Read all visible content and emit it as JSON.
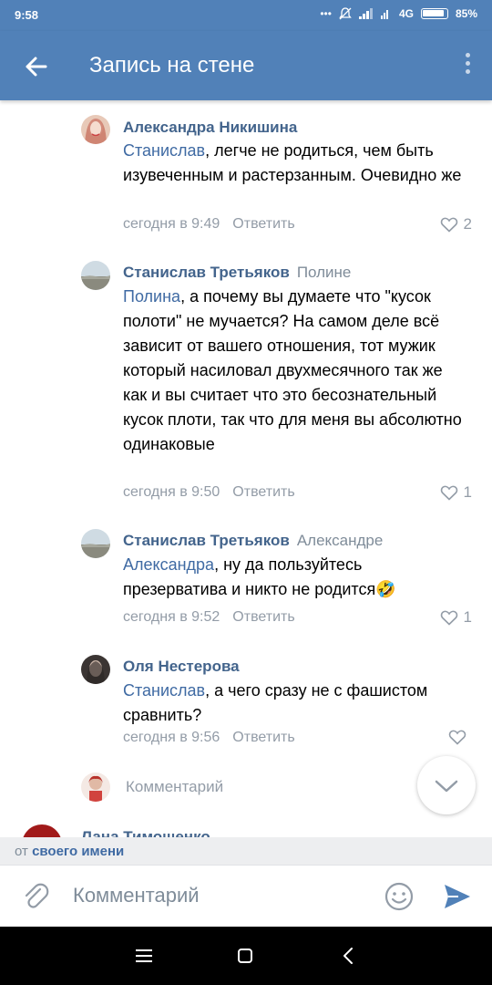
{
  "status": {
    "time": "9:58",
    "network": "4G",
    "battery": "85%"
  },
  "header": {
    "title": "Запись на стене"
  },
  "comments": [
    {
      "author": "Александра Никишина",
      "reply_to": "",
      "mention": "Станислав",
      "text": ", легче не родиться, чем быть изувеченным и растерзанным. Очевидно же",
      "time": "сегодня в 9:49",
      "reply": "Ответить",
      "likes": "2"
    },
    {
      "author": "Станислав Третьяков",
      "reply_to": "Полине",
      "mention": "Полина",
      "text": ", а почему вы думаете что \"кусок полоти\" не мучается? На самом деле всё зависит от вашего отношения, тот мужик который насиловал двухмесячного так же как и вы считает что это бесознательный кусок плоти, так что для меня вы абсолютно одинаковые",
      "time": "сегодня в 9:50",
      "reply": "Ответить",
      "likes": "1"
    },
    {
      "author": "Станислав Третьяков",
      "reply_to": "Александре",
      "mention": "Александра",
      "text": ", ну да пользуйтесь презерватива и никто не родится",
      "emoji": "🤣",
      "time": "сегодня в 9:52",
      "reply": "Ответить",
      "likes": "1"
    },
    {
      "author": "Оля Нестерова",
      "reply_to": "",
      "mention": "Станислав",
      "text": ", а чего сразу не с фашистом сравнить?",
      "time": "сегодня в 9:56",
      "reply": "Ответить",
      "likes": ""
    }
  ],
  "reply_box": {
    "placeholder": "Комментарий"
  },
  "next_author": "Лана Тимошенко",
  "from_bar": {
    "prefix": "от",
    "name": "своего имени"
  },
  "input": {
    "placeholder": "Комментарий"
  },
  "colors": {
    "accent": "#5181b8",
    "link": "#43648c",
    "muted": "#939ca7"
  }
}
